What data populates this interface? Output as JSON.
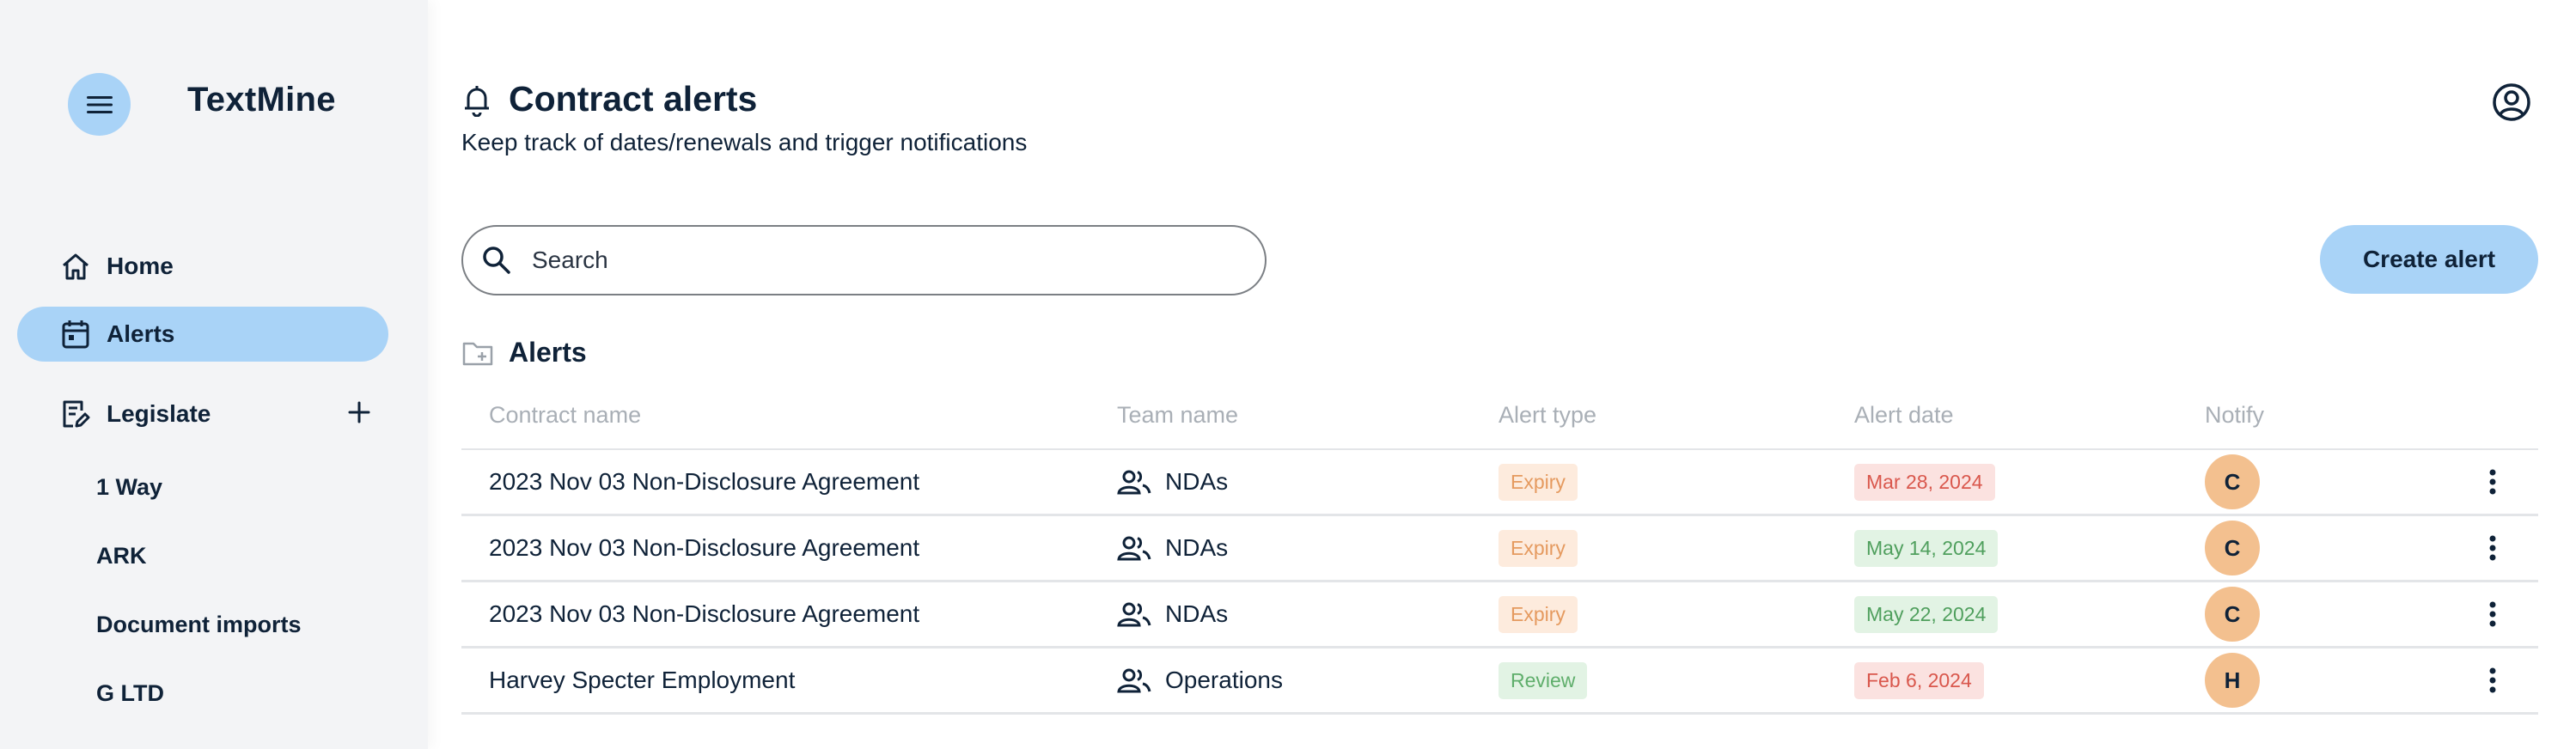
{
  "app": {
    "title": "TextMine"
  },
  "sidebar": {
    "nav": [
      {
        "label": "Home",
        "icon": "home-icon"
      },
      {
        "label": "Alerts",
        "icon": "calendar-icon",
        "active": true
      },
      {
        "label": "Legislate",
        "icon": "document-edit-icon"
      }
    ],
    "sub_items": [
      "1 Way",
      "ARK",
      "Document imports",
      "G LTD"
    ]
  },
  "header": {
    "title": "Contract alerts",
    "subtitle": "Keep track of dates/renewals and trigger notifications"
  },
  "search": {
    "placeholder": "Search",
    "value": ""
  },
  "create_button": {
    "label": "Create alert"
  },
  "section": {
    "title": "Alerts"
  },
  "table": {
    "columns": [
      "Contract name",
      "Team name",
      "Alert type",
      "Alert date",
      "Notify"
    ],
    "rows": [
      {
        "contract": "2023 Nov 03 Non-Disclosure Agreement",
        "team": "NDAs",
        "type": "Expiry",
        "date": "Mar 28, 2024",
        "notify": "C"
      },
      {
        "contract": "2023 Nov 03 Non-Disclosure Agreement",
        "team": "NDAs",
        "type": "Expiry",
        "date": "May 14, 2024",
        "notify": "C"
      },
      {
        "contract": "2023 Nov 03 Non-Disclosure Agreement",
        "team": "NDAs",
        "type": "Expiry",
        "date": "May 22, 2024",
        "notify": "C"
      },
      {
        "contract": "Harvey Specter Employment",
        "team": "Operations",
        "type": "Review",
        "date": "Feb 6, 2024",
        "notify": "H"
      }
    ]
  },
  "colors": {
    "accent": "#a9d3f7",
    "expiry_bg": "#fdebdd",
    "expiry_fg": "#e59a5f",
    "review_bg": "#e2f3e4",
    "review_fg": "#5fae6b",
    "date_red_bg": "#fbe2e0",
    "date_red_fg": "#d9574c",
    "date_green_bg": "#e2f3e4",
    "date_green_fg": "#4f9f5d",
    "avatar": "#f3c08f"
  }
}
